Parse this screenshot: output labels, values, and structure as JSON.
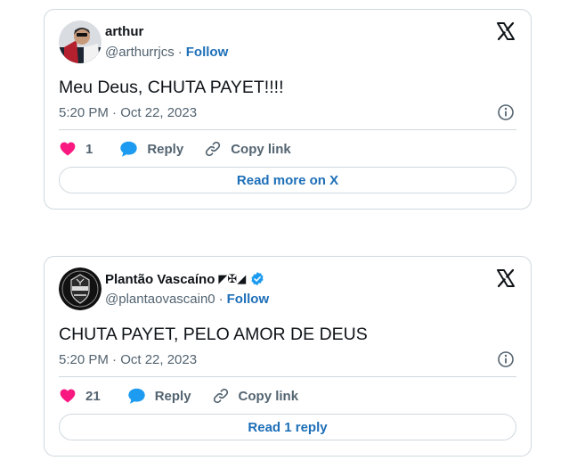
{
  "tweets": [
    {
      "name": "arthur",
      "handle": "@arthurrjcs",
      "separator": "·",
      "follow": "Follow",
      "text": "Meu Deus, CHUTA PAYET!!!!",
      "time": "5:20 PM · Oct 22, 2023",
      "likes": "1",
      "reply_label": "Reply",
      "copy_label": "Copy link",
      "cta": "Read more on X",
      "verified": false
    },
    {
      "name": "Plantão Vascaíno",
      "name_flags": "◤✠◢",
      "handle": "@plantaovascain0",
      "separator": "·",
      "follow": "Follow",
      "text": "CHUTA PAYET, PELO AMOR DE DEUS",
      "time": "5:20 PM · Oct 22, 2023",
      "likes": "21",
      "reply_label": "Reply",
      "copy_label": "Copy link",
      "cta": "Read 1 reply",
      "verified": true
    }
  ],
  "colors": {
    "like": "#f91880",
    "reply": "#1d9bf0",
    "link": "#1d6fb8",
    "verified": "#1d9bf0",
    "border": "#cfd9de",
    "muted": "#536471"
  },
  "icons": [
    "x-logo-icon",
    "info-icon",
    "heart-icon",
    "reply-bubble-icon",
    "copy-link-icon",
    "verified-badge-icon"
  ]
}
